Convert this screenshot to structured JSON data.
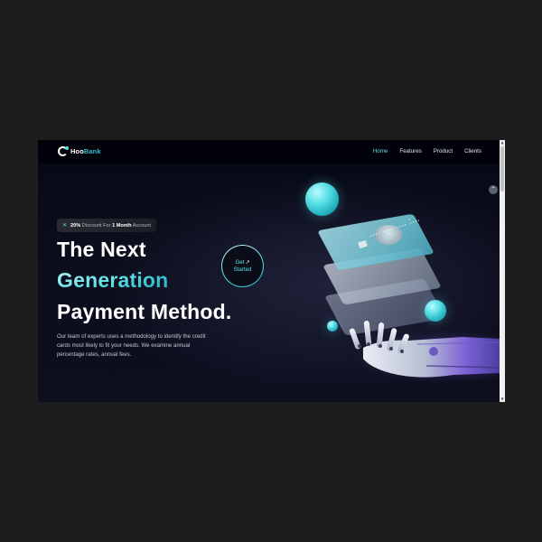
{
  "navbar": {
    "logo": {
      "brand_part_1": "Hoo",
      "brand_part_2": "Bank"
    },
    "links": [
      {
        "label": "Home",
        "active": true
      },
      {
        "label": "Features",
        "active": false
      },
      {
        "label": "Product",
        "active": false
      },
      {
        "label": "Clients",
        "active": false
      }
    ]
  },
  "hero": {
    "badge": {
      "pct": "20%",
      "text_a": "Discount For",
      "bold": "1 Month",
      "text_b": "Account"
    },
    "line1": "The Next",
    "line2": "Generation",
    "line3": "Payment Method.",
    "description": "Our team of experts uses a methodology to identify the credit cards most likely to fit your needs. We examine annual percentage rates, annual fees.",
    "cta": {
      "line1": "Get",
      "line2": "Started"
    }
  },
  "colors": {
    "accent": "#5ce1e6",
    "accent_dark": "#33bbcf",
    "background": "#00040f"
  },
  "icons": {
    "discount": "discount-icon",
    "arrow": "arrow-up-right-icon"
  }
}
